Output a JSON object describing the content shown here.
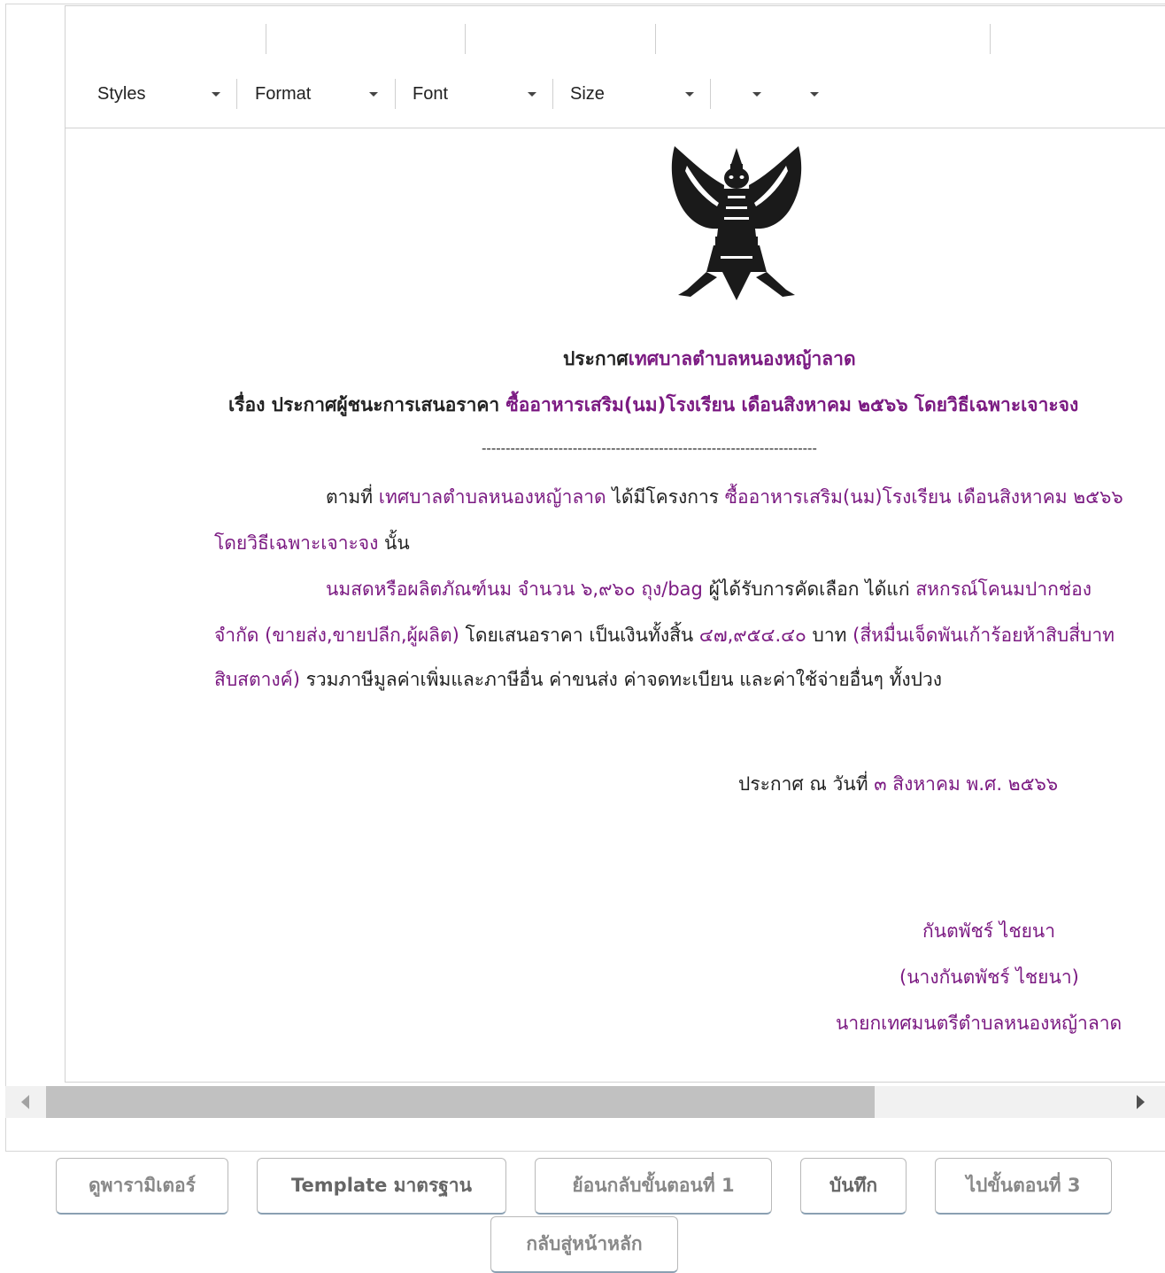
{
  "toolbar": {
    "styles_label": "Styles",
    "format_label": "Format",
    "font_label": "Font",
    "size_label": "Size",
    "color_label": "",
    "bgcolor_label": ""
  },
  "document": {
    "emblem_icon": "garuda-emblem-icon",
    "header": {
      "line1_prefix": "ประกาศ",
      "line1_org": "เทศบาลตำบลหนองหญ้าลาด",
      "line2_prefix": "เรื่อง ประกาศผู้ชนะการเสนอราคา ",
      "line2_subject": "ซื้ออาหารเสริม(นม)โรงเรียน เดือนสิงหาคม ๒๕๖๖ โดยวิธีเฉพาะเจาะจง"
    },
    "divider": "----------------------------------------------------------------------",
    "para1": {
      "t1": "ตามที่ ",
      "org": "เทศบาลตำบลหนองหญ้าลาด",
      "t2": " ได้มีโครงการ ",
      "project": "ซื้ออาหารเสริม(นม)โรงเรียน เดือนสิงหาคม ๒๕๖๖",
      "method": "โดยวิธีเฉพาะเจาะจง",
      "t3": "  นั้น"
    },
    "para2": {
      "item": "นมสดหรือผลิตภัณฑ์นม จำนวน ๖,๙๖๐ ถุง/bag",
      "t1": " ผู้ได้รับการคัดเลือก ได้แก่ ",
      "winner_l1": "สหกรณ์โคนมปากช่อง",
      "winner_l2": "จำกัด (ขายส่ง,ขายปลีก,ผู้ผลิต)",
      "t2": " โดยเสนอราคา เป็นเงินทั้งสิ้น ",
      "amount": "๔๗,๙๕๔.๔๐",
      "t3": " บาท ",
      "amount_words_l1": "(สี่หมื่นเจ็ดพันเก้าร้อยห้าสิบสี่บาท",
      "amount_words_l2": "สิบสตางค์)",
      "t4": " รวมภาษีมูลค่าเพิ่มและภาษีอื่น ค่าขนส่ง ค่าจดทะเบียน และค่าใช้จ่ายอื่นๆ ทั้งปวง"
    },
    "date": {
      "prefix": "ประกาศ ณ วันที่  ",
      "value": "๓ สิงหาคม พ.ศ. ๒๕๖๖"
    },
    "signature": {
      "name": "กันตพัชร์ ไชยนา",
      "full_name": "(นางกันตพัชร์ ไชยนา)",
      "position": "นายกเทศมนตรีตำบลหนองหญ้าลาด"
    }
  },
  "buttons": {
    "view_params": "ดูพารามิเตอร์",
    "standard_template": "Template มาตรฐาน",
    "back_step1": "ย้อนกลับขั้นตอนที่ 1",
    "save": "บันทึก",
    "next_step3": "ไปขั้นตอนที่ 3",
    "back_home": "กลับสู่หน้าหลัก"
  },
  "colors": {
    "highlight": "#7b1a82",
    "text": "#222222"
  }
}
